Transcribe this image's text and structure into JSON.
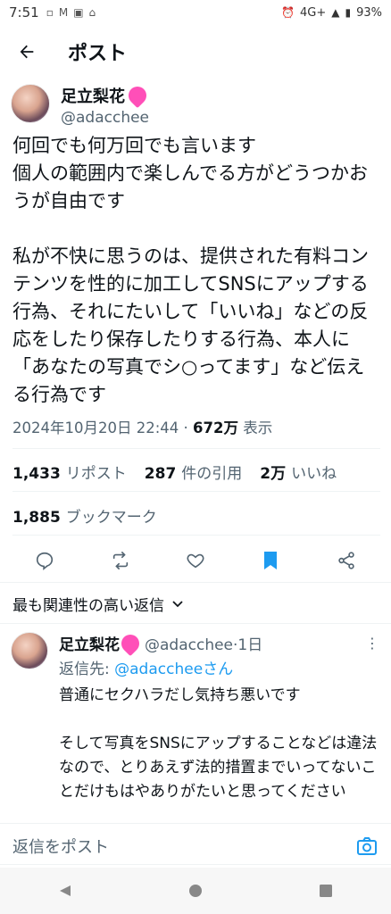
{
  "status_bar": {
    "time": "7:51",
    "network": "4G+",
    "battery": "93%",
    "left_icons": [
      "sim-icon",
      "gmail-icon",
      "gallery-icon",
      "home-icon"
    ],
    "right_icons": [
      "alarm-icon",
      "signal-icon",
      "battery-icon"
    ]
  },
  "header": {
    "title": "ポスト"
  },
  "author": {
    "name": "足立梨花",
    "handle": "@adacchee",
    "badge_icon": "peach-emoji"
  },
  "tweet": {
    "paragraphs": [
      "何回でも何万回でも言います\n個人の範囲内で楽しんでる方がどうつかおうが自由です",
      "私が不快に思うのは、提供された有料コンテンツを性的に加工してSNSにアップする行為、それにたいして「いいね」などの反応をしたり保存したりする行為、本人に「あなたの写真でシ○ってます」など伝える行為です"
    ],
    "timestamp": "2024年10月20日 22:44",
    "separator": "·",
    "views": "672万",
    "views_label": "表示"
  },
  "stats": {
    "reposts": "1,433",
    "reposts_label": "リポスト",
    "quotes": "287",
    "quotes_label": "件の引用",
    "likes": "2万",
    "likes_label": "いいね",
    "bookmarks": "1,885",
    "bookmarks_label": "ブックマーク"
  },
  "actions": [
    "reply-icon",
    "repost-icon",
    "like-icon",
    "bookmark-icon",
    "share-icon"
  ],
  "colors": {
    "accent": "#1d9bf0",
    "text": "#0f1419",
    "muted": "#536471",
    "divider": "#eff3f4"
  },
  "sort_label": "最も関連性の高い返信",
  "reply": {
    "name": "足立梨花",
    "handle": "@adacchee",
    "time": "1日",
    "separator": "·",
    "reply_to_label": "返信先:",
    "reply_to": "@adaccheeさん",
    "paragraphs": [
      "普通にセクハラだし気持ち悪いです",
      "そして写真をSNSにアップすることなどは違法なので、とりあえず法的措置までいってないことだけもはやありがたいと思ってください"
    ]
  },
  "reply_bar": {
    "placeholder": "返信をポスト"
  }
}
